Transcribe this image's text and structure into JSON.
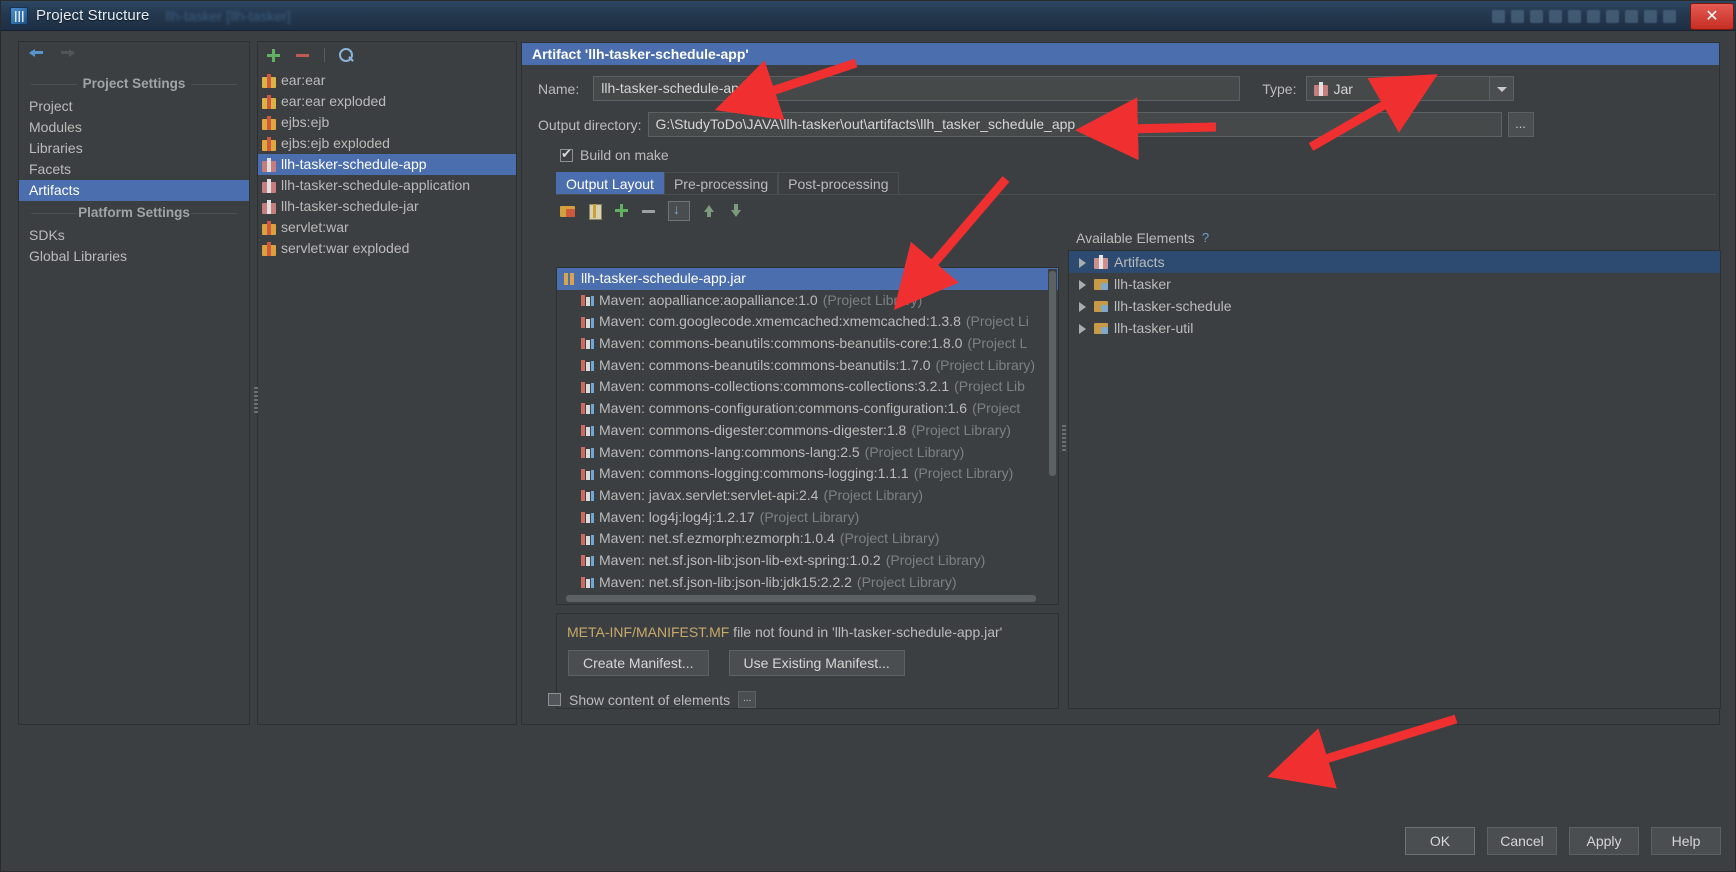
{
  "window": {
    "title": "Project Structure",
    "ghost_title": "llh-tasker [llh-tasker]",
    "close_label": "✕"
  },
  "left_nav": {
    "groups": [
      {
        "title": "Project Settings",
        "items": [
          {
            "label": "Project",
            "selected": false
          },
          {
            "label": "Modules",
            "selected": false
          },
          {
            "label": "Libraries",
            "selected": false
          },
          {
            "label": "Facets",
            "selected": false
          },
          {
            "label": "Artifacts",
            "selected": true
          }
        ]
      },
      {
        "title": "Platform Settings",
        "items": [
          {
            "label": "SDKs",
            "selected": false
          },
          {
            "label": "Global Libraries",
            "selected": false
          }
        ]
      }
    ]
  },
  "artifact_list": {
    "toolbar": {
      "add": "add-icon",
      "remove": "remove-icon",
      "find": "search-icon"
    },
    "items": [
      {
        "label": "ear:ear",
        "icon": "ear",
        "selected": false
      },
      {
        "label": "ear:ear exploded",
        "icon": "ear",
        "selected": false
      },
      {
        "label": "ejbs:ejb",
        "icon": "ejb",
        "selected": false
      },
      {
        "label": "ejbs:ejb exploded",
        "icon": "ejb",
        "selected": false
      },
      {
        "label": "llh-tasker-schedule-app",
        "icon": "jar",
        "selected": true
      },
      {
        "label": "llh-tasker-schedule-application",
        "icon": "jar",
        "selected": false
      },
      {
        "label": "llh-tasker-schedule-jar",
        "icon": "jar",
        "selected": false
      },
      {
        "label": "servlet:war",
        "icon": "war",
        "selected": false
      },
      {
        "label": "servlet:war exploded",
        "icon": "war",
        "selected": false
      }
    ]
  },
  "detail": {
    "header": "Artifact 'llh-tasker-schedule-app'",
    "name_label": "Name:",
    "name_value": "llh-tasker-schedule-app",
    "type_label": "Type:",
    "type_value": "Jar",
    "output_label": "Output directory:",
    "output_value": "G:\\StudyToDo\\JAVA\\llh-tasker\\out\\artifacts\\llh_tasker_schedule_app",
    "browse_label": "...",
    "build_on_make_label": "Build on make",
    "build_on_make_checked": true,
    "tabs": [
      {
        "label": "Output Layout",
        "active": true
      },
      {
        "label": "Pre-processing",
        "active": false
      },
      {
        "label": "Post-processing",
        "active": false
      }
    ],
    "layout_toolbar": [
      {
        "name": "add-directory-icon"
      },
      {
        "name": "add-archive-icon"
      },
      {
        "name": "add-element-icon"
      },
      {
        "name": "remove-element-icon"
      },
      {
        "name": "sort-icon"
      },
      {
        "name": "move-up-icon"
      },
      {
        "name": "move-down-icon"
      }
    ]
  },
  "output_layout": {
    "root": {
      "label": "llh-tasker-schedule-app.jar",
      "selected": true
    },
    "entries": [
      {
        "main": "Maven: aopalliance:aopalliance:1.0",
        "note": "(Project Library)"
      },
      {
        "main": "Maven: com.googlecode.xmemcached:xmemcached:1.3.8",
        "note": "(Project Li"
      },
      {
        "main": "Maven: commons-beanutils:commons-beanutils-core:1.8.0",
        "note": "(Project L"
      },
      {
        "main": "Maven: commons-beanutils:commons-beanutils:1.7.0",
        "note": "(Project Library)"
      },
      {
        "main": "Maven: commons-collections:commons-collections:3.2.1",
        "note": "(Project Lib"
      },
      {
        "main": "Maven: commons-configuration:commons-configuration:1.6",
        "note": "(Project"
      },
      {
        "main": "Maven: commons-digester:commons-digester:1.8",
        "note": "(Project Library)"
      },
      {
        "main": "Maven: commons-lang:commons-lang:2.5",
        "note": "(Project Library)"
      },
      {
        "main": "Maven: commons-logging:commons-logging:1.1.1",
        "note": "(Project Library)"
      },
      {
        "main": "Maven: javax.servlet:servlet-api:2.4",
        "note": "(Project Library)"
      },
      {
        "main": "Maven: log4j:log4j:1.2.17",
        "note": "(Project Library)"
      },
      {
        "main": "Maven: net.sf.ezmorph:ezmorph:1.0.4",
        "note": "(Project Library)"
      },
      {
        "main": "Maven: net.sf.json-lib:json-lib-ext-spring:1.0.2",
        "note": "(Project Library)"
      },
      {
        "main": "Maven: net.sf.json-lib:json-lib:jdk15:2.2.2",
        "note": "(Project Library)"
      }
    ]
  },
  "manifest": {
    "message_prefix": "META-INF/MANIFEST.MF",
    "message_rest": " file not found in 'llh-tasker-schedule-app.jar'",
    "create_label": "Create Manifest...",
    "use_existing_label": "Use Existing Manifest..."
  },
  "available_elements": {
    "title": "Available Elements",
    "help": "?",
    "items": [
      {
        "label": "Artifacts",
        "icon": "artifact",
        "selected": true
      },
      {
        "label": "llh-tasker",
        "icon": "module",
        "selected": false
      },
      {
        "label": "llh-tasker-schedule",
        "icon": "module",
        "selected": false
      },
      {
        "label": "llh-tasker-util",
        "icon": "module",
        "selected": false
      }
    ]
  },
  "footer": {
    "show_content_label": "Show content of elements",
    "show_content_checked": false,
    "show_content_ellipsis": "...",
    "buttons": [
      {
        "label": "OK",
        "primary": true
      },
      {
        "label": "Cancel",
        "primary": false
      },
      {
        "label": "Apply",
        "primary": false
      },
      {
        "label": "Help",
        "primary": false
      }
    ]
  },
  "colors": {
    "accent": "#4b6eaf",
    "background": "#3c3f41",
    "annotation": "#f03030"
  }
}
